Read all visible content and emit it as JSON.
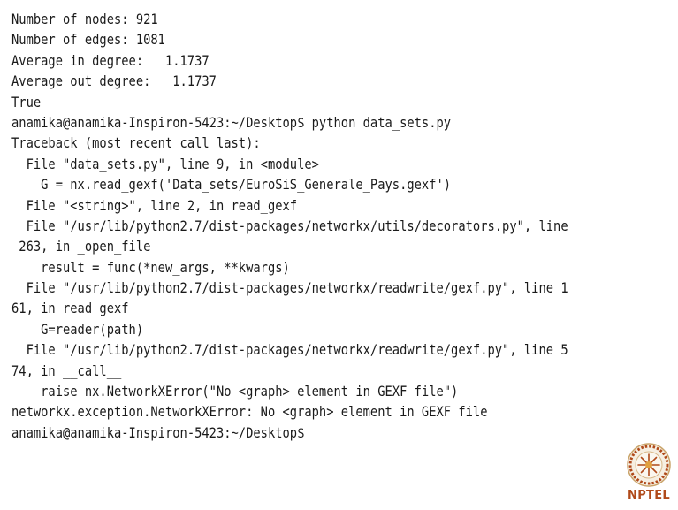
{
  "terminal": {
    "lines": [
      "Number of nodes: 921",
      "Number of edges: 1081",
      "Average in degree:   1.1737",
      "Average out degree:   1.1737",
      "True",
      "anamika@anamika-Inspiron-5423:~/Desktop$ python data_sets.py",
      "Traceback (most recent call last):",
      "  File \"data_sets.py\", line 9, in <module>",
      "    G = nx.read_gexf('Data_sets/EuroSiS_Generale_Pays.gexf')",
      "  File \"<string>\", line 2, in read_gexf",
      "  File \"/usr/lib/python2.7/dist-packages/networkx/utils/decorators.py\", line",
      " 263, in _open_file",
      "    result = func(*new_args, **kwargs)",
      "  File \"/usr/lib/python2.7/dist-packages/networkx/readwrite/gexf.py\", line 1",
      "61, in read_gexf",
      "    G=reader(path)",
      "  File \"/usr/lib/python2.7/dist-packages/networkx/readwrite/gexf.py\", line 5",
      "74, in __call__",
      "    raise nx.NetworkXError(\"No <graph> element in GEXF file\")",
      "networkx.exception.NetworkXError: No <graph> element in GEXF file",
      "anamika@anamika-Inspiron-5423:~/Desktop$"
    ]
  },
  "logo": {
    "text": "NPTEL",
    "icon": "nptel-emblem-icon",
    "color": "#b04a1a"
  }
}
